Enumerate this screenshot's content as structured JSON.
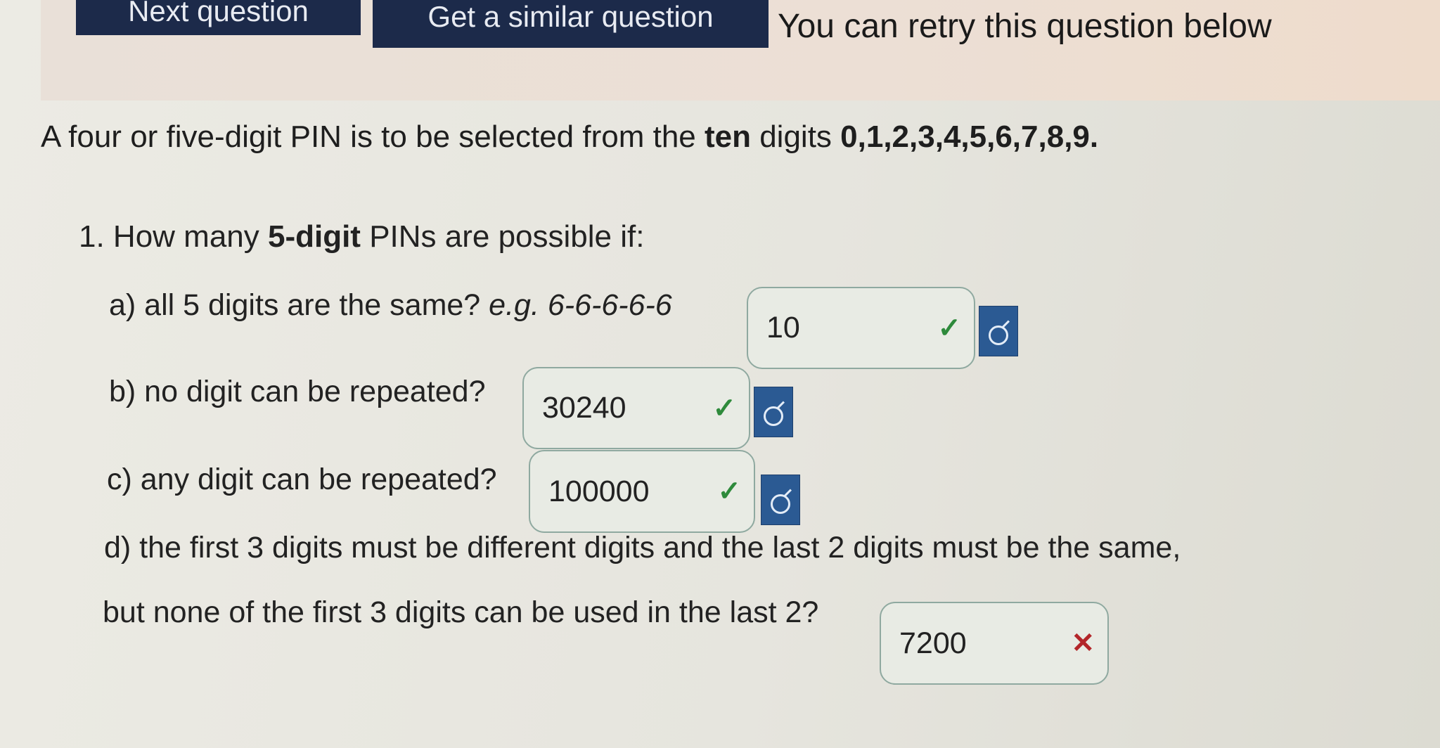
{
  "header": {
    "next_question_label": "Next question",
    "similar_question_label": "Get a similar question",
    "retry_note": "You can retry this question below"
  },
  "question": {
    "stem_prefix": "A four or five-digit PIN is to be selected from the ",
    "stem_bold_1": "ten",
    "stem_mid": " digits ",
    "stem_bold_2": "0,1,2,3,4,5,6,7,8,9.",
    "heading_prefix": "1. How many ",
    "heading_bold": "5-digit",
    "heading_suffix": " PINs are possible if:",
    "parts": [
      {
        "label": "a) all 5 digits are the same? ",
        "example": "e.g. 6-6-6-6-6",
        "answer": "10",
        "status": "correct"
      },
      {
        "label": "b) no digit can be repeated?",
        "answer": "30240",
        "status": "correct"
      },
      {
        "label": "c) any digit can be repeated?",
        "answer": "100000",
        "status": "correct"
      },
      {
        "label_line1": "d) the first 3 digits must be different digits and the last 2 digits must be the same,",
        "label_line2": "but none of the first 3 digits can be used in the last 2?",
        "answer": "7200",
        "status": "incorrect"
      }
    ]
  },
  "icons": {
    "check": "✓",
    "cross": "✕",
    "key": "key-icon"
  },
  "colors": {
    "button_dark": "#1c2a4a",
    "key_button": "#2b5a93",
    "correct": "#2e8a3b",
    "incorrect": "#b3262a"
  }
}
